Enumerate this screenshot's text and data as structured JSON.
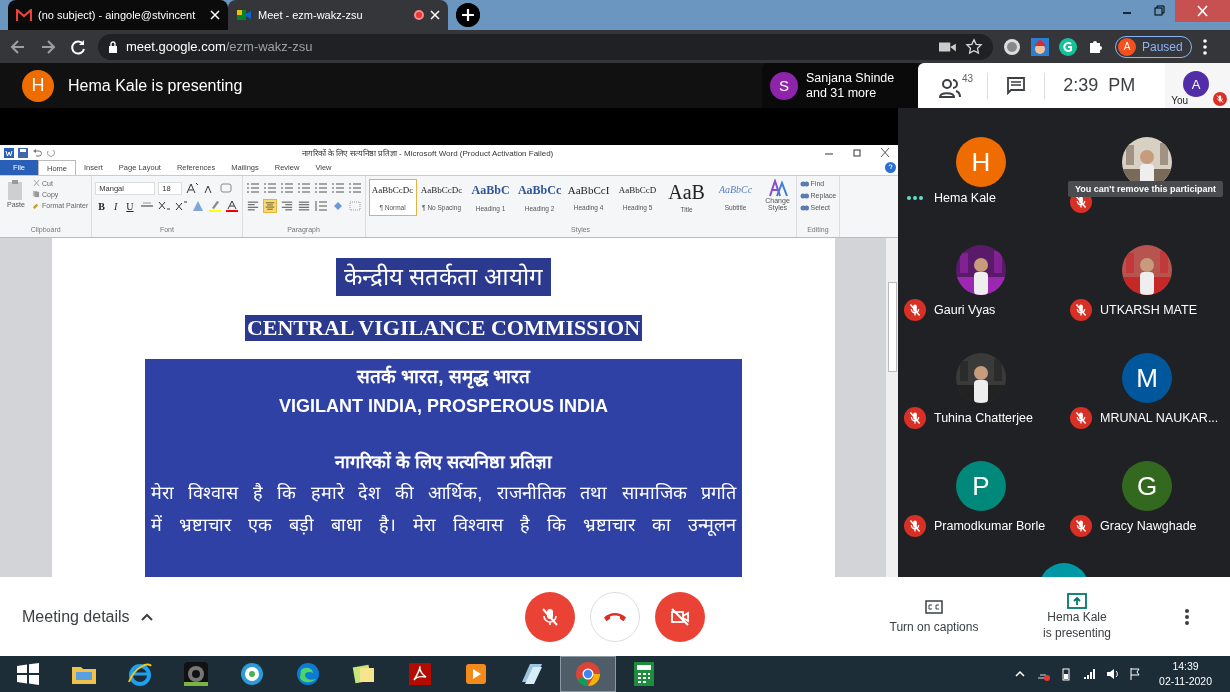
{
  "browser": {
    "tabs": [
      {
        "title": "(no subject) - aingole@stvincent",
        "kind": "mail",
        "selected": false,
        "recording": false
      },
      {
        "title": "Meet - ezm-wakz-zsu",
        "kind": "meet",
        "selected": true,
        "recording": true
      }
    ],
    "address": {
      "host": "meet.google.com",
      "path": "/ezm-wakz-zsu"
    },
    "profile": {
      "initial": "A",
      "status": "Paused"
    }
  },
  "meet_header": {
    "presenter": {
      "initial": "H",
      "text": "Hema Kale is presenting"
    },
    "others": {
      "initial": "S",
      "lines": [
        "Sanjana Shinde",
        "and 31 more"
      ]
    },
    "participant_count": "43",
    "time": "2:39  PM",
    "self": {
      "initial": "A",
      "label": "You",
      "muted": true
    }
  },
  "word": {
    "title": "नागरिकों के लिए सत्यनिष्ठा प्रतिज्ञा - Microsoft Word (Product Activation Failed)",
    "tabs": [
      {
        "label": "File",
        "kind": "file",
        "selected": false
      },
      {
        "label": "Home",
        "kind": "tab",
        "selected": true
      },
      {
        "label": "Insert",
        "kind": "tab",
        "selected": false
      },
      {
        "label": "Page Layout",
        "kind": "tab",
        "selected": false
      },
      {
        "label": "References",
        "kind": "tab",
        "selected": false
      },
      {
        "label": "Mailings",
        "kind": "tab",
        "selected": false
      },
      {
        "label": "Review",
        "kind": "tab",
        "selected": false
      },
      {
        "label": "View",
        "kind": "tab",
        "selected": false
      }
    ],
    "clipboard": {
      "paste": "Paste",
      "items": [
        "Cut",
        "Copy",
        "Format Painter"
      ],
      "label": "Clipboard"
    },
    "font": {
      "name": "Mangal",
      "size": "18",
      "format_buttons": [
        "B",
        "I",
        "U"
      ],
      "label": "Font"
    },
    "paragraph": {
      "alignments": [
        {
          "kind": "left",
          "selected": false
        },
        {
          "kind": "center",
          "selected": true
        },
        {
          "kind": "right",
          "selected": false
        },
        {
          "kind": "justify",
          "selected": false
        }
      ],
      "label": "Paragraph"
    },
    "styles": {
      "items": [
        {
          "preview": "AaBbCcDc",
          "label": "¶ Normal",
          "kind": "normal",
          "selected": true
        },
        {
          "preview": "AaBbCcDc",
          "label": "¶ No Spacing",
          "kind": "normal",
          "selected": false
        },
        {
          "preview": "AaBbC",
          "label": "Heading 1",
          "kind": "heading",
          "selected": false
        },
        {
          "preview": "AaBbCc",
          "label": "Heading 2",
          "kind": "heading",
          "selected": false
        },
        {
          "preview": "AaBbCcI",
          "label": "Heading 4",
          "kind": "serif",
          "selected": false
        },
        {
          "preview": "AaBbCcD",
          "label": "Heading 5",
          "kind": "serif-small",
          "selected": false
        },
        {
          "preview": "AaB",
          "label": "Title",
          "kind": "title",
          "selected": false
        },
        {
          "preview": "AaBbCc",
          "label": "Subtitle",
          "kind": "subtitle",
          "selected": false
        }
      ],
      "change": "Change Styles",
      "label": "Styles"
    },
    "editing": {
      "items": [
        "Find",
        "Replace",
        "Select"
      ],
      "label": "Editing"
    }
  },
  "document": {
    "heading_hindi": "केन्द्रीय सतर्कता आयोग",
    "heading_english": "CENTRAL VIGILANCE COMMISSION",
    "box": {
      "motto_hindi": "सतर्क भारत, समृद्ध भारत",
      "motto_english": "VIGILANT INDIA, PROSPEROUS INDIA",
      "pledge_title": "नागरिकों के लिए सत्यनिष्ठा प्रतिज्ञा",
      "lines": [
        "मेरा विश्वास है कि हमारे देश की आर्थिक, राजनीतिक तथा सामाजिक प्रगति",
        "में भ्रष्टाचार एक बड़ी बाधा है। मेरा विश्वास है कि भ्रष्टाचार का उन्मूलन"
      ]
    }
  },
  "participants": [
    {
      "kind": "letter",
      "initial": "H",
      "color": "#ef6c00",
      "name": "Hema Kale",
      "muted": false
    },
    {
      "kind": "picture",
      "muted": true,
      "tooltip": "You can't remove this participant"
    },
    {
      "kind": "picture",
      "name": "Gauri Vyas",
      "muted": true
    },
    {
      "kind": "picture",
      "name": "UTKARSH MATE",
      "muted": true
    },
    {
      "kind": "picture",
      "name": "Tuhina Chatterjee",
      "muted": true
    },
    {
      "kind": "letter",
      "initial": "M",
      "color": "#01579b",
      "name": "MRUNAL NAUKAR...",
      "muted": true
    },
    {
      "kind": "letter",
      "initial": "P",
      "color": "#00897b",
      "name": "Pramodkumar Borle",
      "muted": true
    },
    {
      "kind": "letter",
      "initial": "G",
      "color": "#33691e",
      "name": "Gracy Nawghade",
      "muted": true
    },
    {
      "kind": "letter",
      "color": "#0097a7"
    }
  ],
  "bottom_bar": {
    "meeting_details": "Meeting details",
    "mic_on": false,
    "camera_on": false,
    "captions": "Turn on captions",
    "presenting": [
      "Hema Kale",
      "is presenting"
    ]
  },
  "taskbar": {
    "apps": [
      {
        "kind": "start",
        "selected": false
      },
      {
        "kind": "folder",
        "selected": false
      },
      {
        "kind": "ie",
        "selected": false
      },
      {
        "kind": "webcam",
        "selected": false
      },
      {
        "kind": "disc",
        "selected": false
      },
      {
        "kind": "edge",
        "selected": false
      },
      {
        "kind": "notes",
        "selected": false
      },
      {
        "kind": "pdf",
        "selected": false
      },
      {
        "kind": "media",
        "selected": false
      },
      {
        "kind": "files",
        "selected": false
      },
      {
        "kind": "chrome",
        "selected": true
      },
      {
        "kind": "calculator",
        "selected": false
      }
    ],
    "time": "14:39",
    "date": "02-11-2020"
  }
}
